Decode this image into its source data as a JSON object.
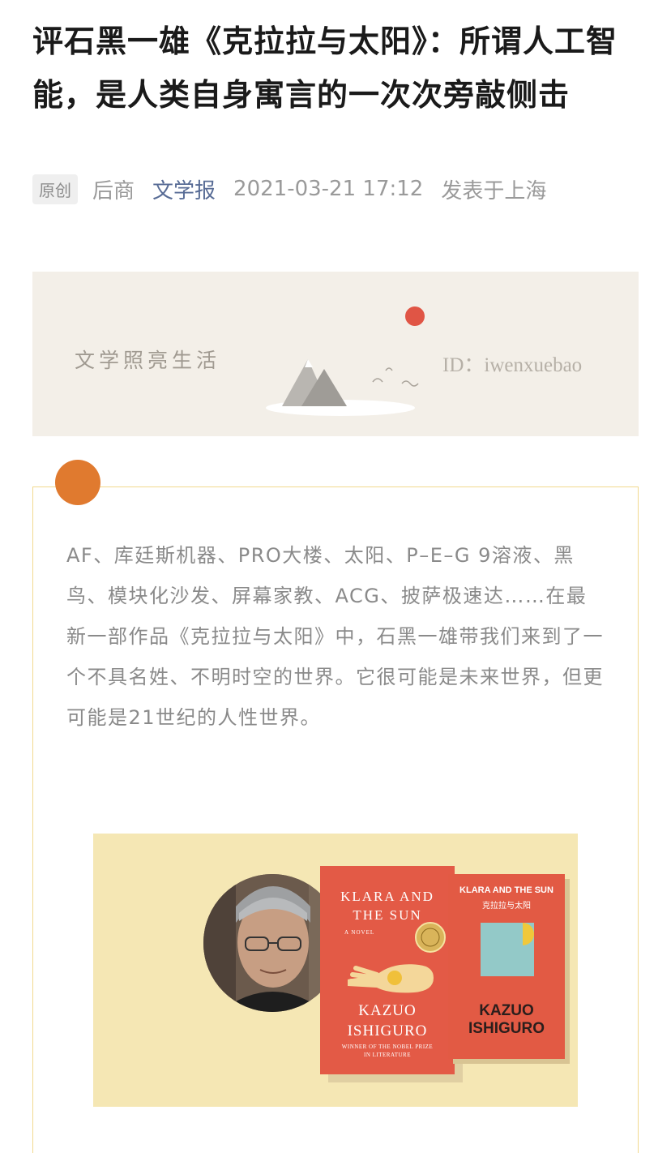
{
  "article": {
    "title": "评石黑一雄《克拉拉与太阳》：所谓人工智能，是人类自身寓言的一次次旁敲侧击",
    "tag": "原创",
    "author": "后商",
    "account": "文学报",
    "datetime": "2021-03-21 17:12",
    "location": "发表于上海"
  },
  "banner": {
    "slogan": "文学照亮生活",
    "id_text": "ID：iwenxuebao"
  },
  "intro": {
    "text": "AF、库廷斯机器、PRO大楼、太阳、P–E–G 9溶液、黑鸟、模块化沙发、屏幕家教、ACG、披萨极速达……在最新一部作品《克拉拉与太阳》中，石黑一雄带我们来到了一个不具名姓、不明时空的世界。它很可能是未来世界，但更可能是21世纪的人性世界。"
  },
  "cover_image": {
    "book1": {
      "title_line1": "KLARA AND",
      "title_line2": "THE SUN",
      "subtitle": "A NOVEL",
      "author_line1": "KAZUO",
      "author_line2": "ISHIGURO",
      "award_line1": "WINNER OF THE NOBEL PRIZE",
      "award_line2": "IN LITERATURE"
    },
    "book2": {
      "title": "KLARA AND THE SUN",
      "title_cn": "克拉拉与太阳",
      "author_line1": "KAZUO",
      "author_line2": "ISHIGURO"
    }
  },
  "colors": {
    "accent_dot": "#e07a2f",
    "card_border": "#f2d98e",
    "link": "#576b95",
    "book_red": "#e35a46",
    "cover_bg": "#f5e7b4"
  }
}
